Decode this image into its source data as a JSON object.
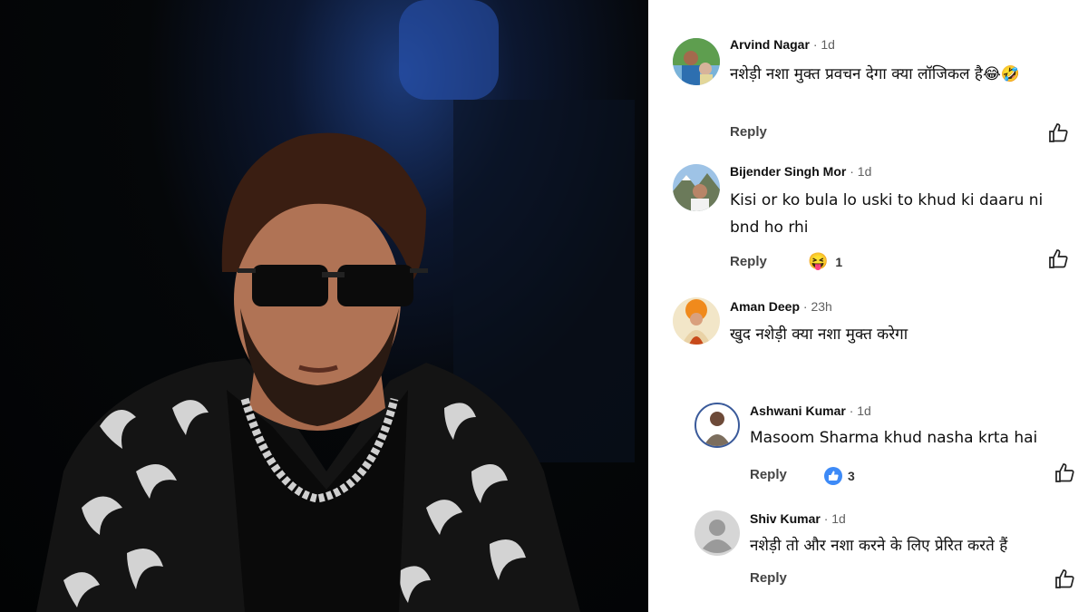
{
  "comments": [
    {
      "author": "Arvind Nagar",
      "time": "· 1d",
      "text": "नशेड़ी नशा मुक्त प्रवचन देगा क्या लॉजिकल है😂🤣",
      "reply": "Reply"
    },
    {
      "author": "Bijender Singh Mor",
      "time": "· 1d",
      "text": "Kisi or ko bula lo uski to khud ki daaru ni bnd ho rhi",
      "reply": "Reply",
      "reaction_emoji": "😝",
      "reaction_count": "1"
    },
    {
      "author": "Aman Deep",
      "time": "· 23h",
      "text": "खुद नशेड़ी क्या नशा मुक्त करेगा"
    }
  ],
  "replies": [
    {
      "author": "Ashwani Kumar",
      "time": "· 1d",
      "text": "Masoom Sharma khud nasha krta hai",
      "reply": "Reply",
      "like_count": "3"
    },
    {
      "author": "Shiv Kumar",
      "time": "· 1d",
      "text": "नशेड़ी तो और नशा करने के लिए प्रेरित करते हैं",
      "reply": "Reply"
    }
  ],
  "colors": {
    "like_accent": "#3d8af7",
    "panel_bg": "#ffffff"
  }
}
